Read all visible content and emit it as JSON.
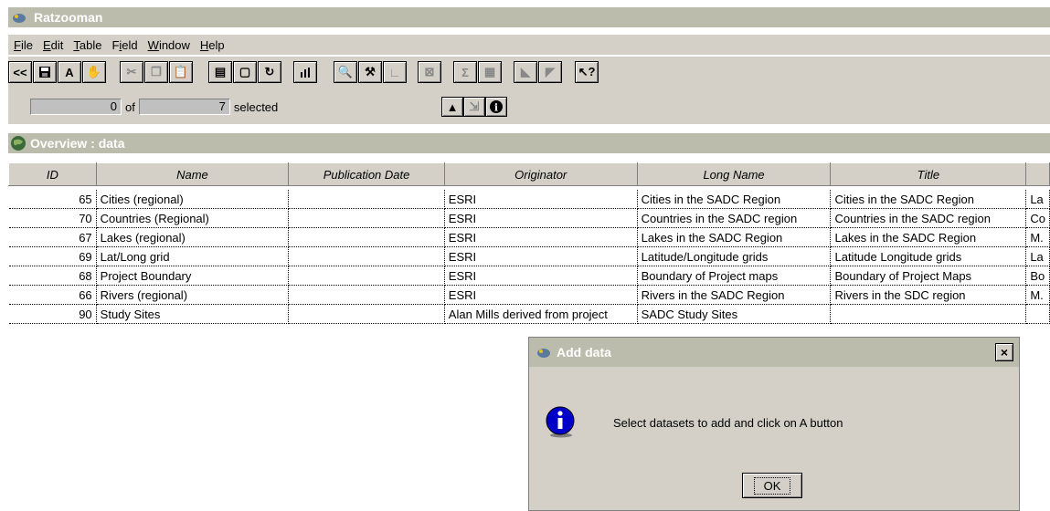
{
  "window": {
    "title": "Ratzooman"
  },
  "menu": [
    "File",
    "Edit",
    "Table",
    "Field",
    "Window",
    "Help"
  ],
  "menu_mnemonics": [
    "F",
    "E",
    "T",
    "i",
    "W",
    "H"
  ],
  "toolbar": {
    "icons": [
      "back-icon",
      "save-icon",
      "text-tool-icon",
      "pan-hand-icon",
      "cut-icon",
      "copy-icon",
      "paste-icon",
      "table-view-icon",
      "form-view-icon",
      "refresh-icon",
      "chart-icon",
      "find-icon",
      "hammer-icon",
      "graph-axes-icon",
      "promote-icon",
      "sum-icon",
      "stats-icon",
      "sort-ascending-icon",
      "sort-descending-icon",
      "help-pointer-icon"
    ]
  },
  "selection": {
    "current": "0",
    "of_label": "of",
    "total": "7",
    "selected_label": "selected"
  },
  "select_tools": [
    "select-arrow-icon",
    "select-cursor-icon",
    "info-icon"
  ],
  "overview": {
    "title": "Overview :   data"
  },
  "table": {
    "columns": [
      "ID",
      "Name",
      "Publication Date",
      "Originator",
      "Long Name",
      "Title",
      ""
    ],
    "rows": [
      [
        "65",
        "Cities (regional)",
        "",
        "ESRI",
        "Cities in the SADC Region",
        "Cities in the SADC Region",
        "La"
      ],
      [
        "70",
        "Countries (Regional)",
        "",
        "ESRI",
        "Countries in the SADC region",
        "Countries in the SADC region",
        "Co"
      ],
      [
        "67",
        "Lakes (regional)",
        "",
        "ESRI",
        "Lakes in the SADC Region",
        "Lakes in the SADC Region",
        "M."
      ],
      [
        "69",
        "Lat/Long grid",
        "",
        "ESRI",
        "Latitude/Longitude grids",
        "Latitude Longitude grids",
        "La"
      ],
      [
        "68",
        "Project Boundary",
        "",
        "ESRI",
        "Boundary of Project maps",
        "Boundary of Project Maps",
        "Bo"
      ],
      [
        "66",
        "Rivers (regional)",
        "",
        "ESRI",
        "Rivers in the SADC Region",
        "Rivers in the SDC region",
        "M."
      ],
      [
        "90",
        "Study Sites",
        "",
        "Alan Mills derived from project",
        "SADC Study Sites",
        "",
        ""
      ]
    ]
  },
  "dialog": {
    "title": "Add data",
    "message": "Select datasets to add and click on A button",
    "ok_label": "OK",
    "close_label": "×"
  },
  "colors": {
    "titlebar": "#bcbcac",
    "face": "#d4d0c8",
    "info_blue": "#0000c8"
  }
}
